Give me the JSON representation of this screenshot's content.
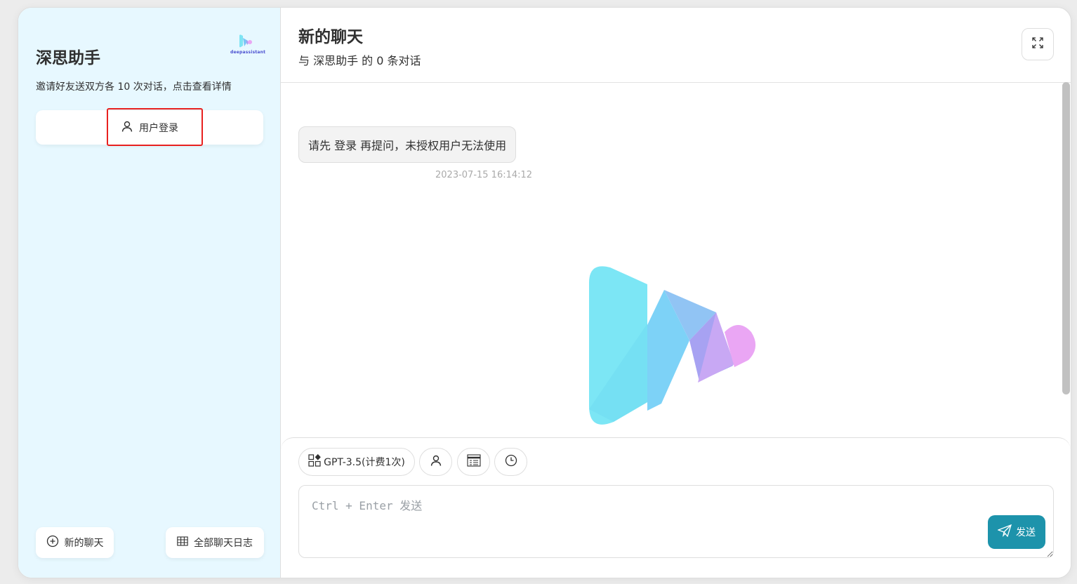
{
  "sidebar": {
    "title": "深思助手",
    "subtitle": "邀请好友送双方各 10 次对话，点击查看详情",
    "logo_text": "deepassistant",
    "login_label": "用户登录",
    "new_chat_label": "新的聊天",
    "all_logs_label": "全部聊天日志"
  },
  "header": {
    "title": "新的聊天",
    "subtitle": "与 深思助手 的 0 条对话"
  },
  "messages": [
    {
      "text": "请先 登录 再提问，未授权用户无法使用",
      "time": "2023-07-15 16:14:12"
    }
  ],
  "input": {
    "model_label": "GPT-3.5(计费1次)",
    "placeholder": "Ctrl + Enter 发送",
    "send_label": "发送"
  },
  "colors": {
    "sidebar_bg": "#e7f8ff",
    "accent": "#1d93ab",
    "highlight": "#e8211f"
  },
  "icons": [
    "user-icon",
    "plus-circle-icon",
    "grid-icon",
    "expand-icon",
    "apps-icon",
    "mask-icon",
    "prompt-icon",
    "clock-icon",
    "send-icon",
    "deepassistant-logo"
  ]
}
